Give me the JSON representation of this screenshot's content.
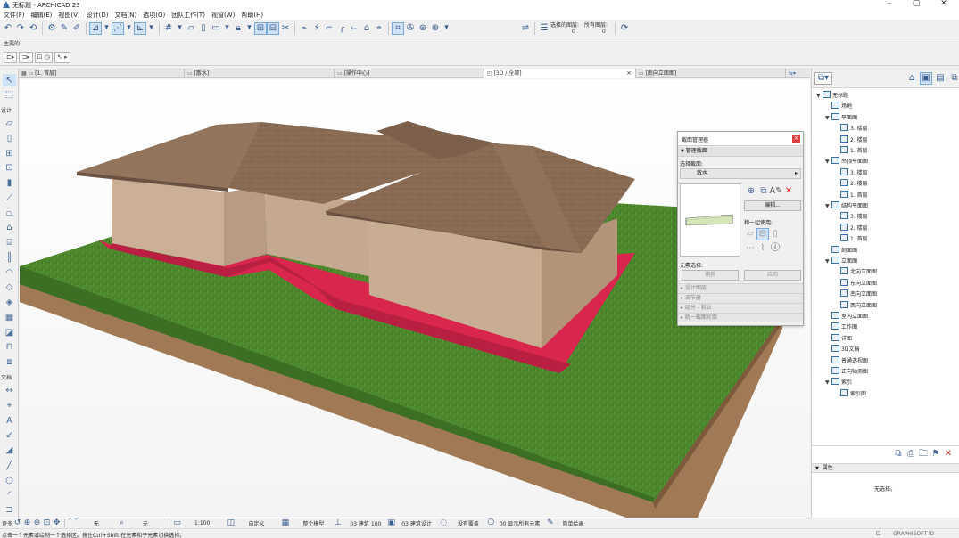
{
  "window": {
    "title": "无标题 - ARCHICAD 23"
  },
  "menu": [
    "文件(F)",
    "编辑(E)",
    "视图(V)",
    "设计(D)",
    "文档(N)",
    "选项(O)",
    "团队工作(T)",
    "视窗(W)",
    "帮助(H)"
  ],
  "toolbar": {
    "selected_level_label": "选择的图层:",
    "selected_level_value": "0",
    "all_layers_label": "所有图层:",
    "all_layers_value": "0"
  },
  "infobox": {
    "label": "主要的:"
  },
  "tabs": [
    {
      "label": "[1. 首层]",
      "active": false
    },
    {
      "label": "[散水]",
      "active": false
    },
    {
      "label": "[操作中心]",
      "active": false
    },
    {
      "label": "[3D / 全部]",
      "active": true,
      "close": "×"
    },
    {
      "label": "[南向立面图]",
      "active": false
    }
  ],
  "toolbox": {
    "design_header": "设计",
    "document_header": "文档",
    "more_label": "更多"
  },
  "navigator": {
    "items": [
      {
        "label": "无标题",
        "level": 0,
        "toggle": "▼"
      },
      {
        "label": "场地",
        "level": 1,
        "toggle": ""
      },
      {
        "label": "平面图",
        "level": 1,
        "toggle": "▼"
      },
      {
        "label": "3. 楼层",
        "level": 2,
        "toggle": ""
      },
      {
        "label": "2. 楼层",
        "level": 2,
        "toggle": ""
      },
      {
        "label": "1. 首层",
        "level": 2,
        "toggle": ""
      },
      {
        "label": "吊顶平面图",
        "level": 1,
        "toggle": "▼"
      },
      {
        "label": "3. 楼层",
        "level": 2,
        "toggle": ""
      },
      {
        "label": "2. 楼层",
        "level": 2,
        "toggle": ""
      },
      {
        "label": "1. 首层",
        "level": 2,
        "toggle": ""
      },
      {
        "label": "结构平面图",
        "level": 1,
        "toggle": "▼"
      },
      {
        "label": "3. 楼层",
        "level": 2,
        "toggle": ""
      },
      {
        "label": "2. 楼层",
        "level": 2,
        "toggle": ""
      },
      {
        "label": "1. 首层",
        "level": 2,
        "toggle": ""
      },
      {
        "label": "剖面图",
        "level": 1,
        "toggle": ""
      },
      {
        "label": "立面图",
        "level": 1,
        "toggle": "▼"
      },
      {
        "label": "北向立面图",
        "level": 2,
        "toggle": ""
      },
      {
        "label": "东向立面图",
        "level": 2,
        "toggle": ""
      },
      {
        "label": "南向立面图",
        "level": 2,
        "toggle": ""
      },
      {
        "label": "西向立面图",
        "level": 2,
        "toggle": ""
      },
      {
        "label": "室内立面图",
        "level": 1,
        "toggle": ""
      },
      {
        "label": "工作图",
        "level": 1,
        "toggle": ""
      },
      {
        "label": "详图",
        "level": 1,
        "toggle": ""
      },
      {
        "label": "3D文档",
        "level": 1,
        "toggle": ""
      },
      {
        "label": "普通透视图",
        "level": 1,
        "toggle": ""
      },
      {
        "label": "正向轴测图",
        "level": 1,
        "toggle": ""
      },
      {
        "label": "索引",
        "level": 1,
        "toggle": "▼"
      },
      {
        "label": "索引图",
        "level": 2,
        "toggle": ""
      }
    ]
  },
  "properties": {
    "header": "属性",
    "empty_text": "无选择。"
  },
  "section_manager": {
    "title": "截面管理器",
    "manage_section_header": "管理截面",
    "select_profile_label": "选择截面:",
    "selected_profile": "散水",
    "edit_button": "编辑...",
    "use_with_label": "和一起使用:",
    "element_selection_label": "元素选择:",
    "pick_button": "捕获",
    "apply_button": "应用",
    "folds": [
      "设计图层",
      "调节器",
      "组分 - 默认",
      "统一截面轮廓"
    ]
  },
  "bottombar": {
    "none_1": "无",
    "none_2": "无",
    "scale": "1:100",
    "custom": "自定义",
    "whole_model": "整个模型",
    "structure": "03 建筑 100",
    "building_design": "03 建筑设计",
    "no_override": "没有覆盖",
    "show_all": "00 显示所有元素",
    "simple_paint": "简单绘画"
  },
  "statusbar": {
    "hint": "点击一个元素或绘制一个选择区。按住Ctrl+Shift 在元素和子元素切换选择。",
    "brand": "GRAPHISOFT ID"
  },
  "colors": {
    "roof": "#8a6b54",
    "wall": "#c9ad93",
    "slab": "#d8264d",
    "grass": "#4e8a2e",
    "soil": "#a17a55",
    "accent": "#3a6fb0"
  }
}
